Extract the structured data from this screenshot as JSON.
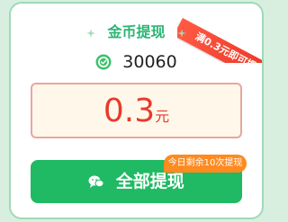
{
  "dialog": {
    "title": "金币提现",
    "ribbon": "满0.3元即可提现",
    "coin_balance": "30060",
    "amount_value": "0.3",
    "amount_unit": "元",
    "withdraw_button": "全部提现",
    "remaining_badge": "今日剩余10次提现",
    "icons": [
      "sparkle-icon",
      "coin-icon",
      "wechat-icon"
    ],
    "colors": {
      "accent": "#2bb673",
      "button": "#1fba63",
      "amount": "#e73a2e",
      "badge": "#ff8a1f",
      "ribbon": "#e8321f"
    }
  }
}
